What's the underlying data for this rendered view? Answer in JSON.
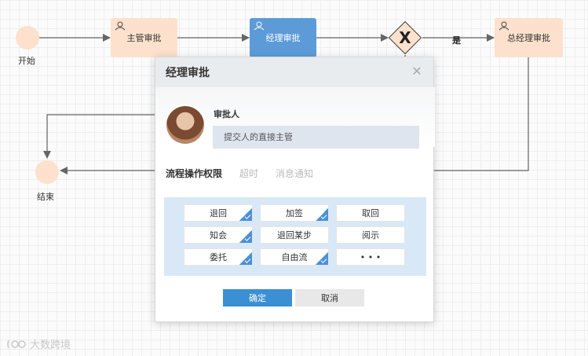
{
  "flow": {
    "start_label": "开始",
    "end_label": "结束",
    "task_supervisor": "主管审批",
    "task_manager": "经理审批",
    "task_gm": "总经理审批",
    "gateway_symbol": "X",
    "edge_yes": "是"
  },
  "modal": {
    "title": "经理审批",
    "close_symbol": "✕",
    "approver_label": "审批人",
    "approver_value": "提交人的直接主管",
    "tabs": [
      {
        "label": "流程操作权限",
        "active": true
      },
      {
        "label": "超时",
        "active": false
      },
      {
        "label": "消息通知",
        "active": false
      }
    ],
    "permissions": [
      {
        "label": "退回",
        "checked": true
      },
      {
        "label": "加签",
        "checked": true
      },
      {
        "label": "取回",
        "checked": false
      },
      {
        "label": "知会",
        "checked": true
      },
      {
        "label": "退回某步",
        "checked": false
      },
      {
        "label": "阅示",
        "checked": false
      },
      {
        "label": "委托",
        "checked": true
      },
      {
        "label": "自由流",
        "checked": true
      },
      {
        "label": "• • •",
        "checked": false
      }
    ],
    "confirm_label": "确定",
    "cancel_label": "取消"
  },
  "watermark": "大数跨境",
  "colors": {
    "node_fill": "#fde1cc",
    "active_task": "#5d9bd8",
    "primary": "#3b8fd3",
    "panel": "#d9e8f6"
  }
}
